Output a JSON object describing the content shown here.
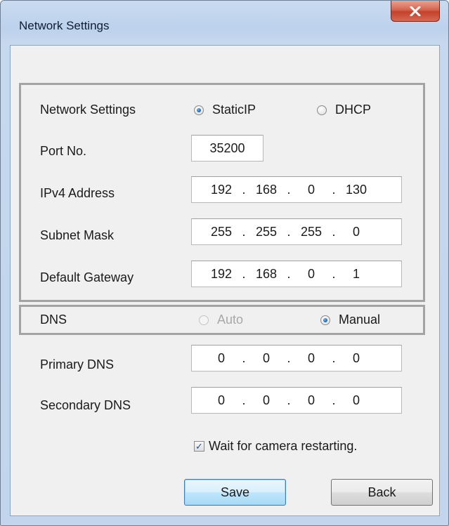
{
  "window": {
    "title": "Network Settings",
    "close_icon": "close-icon"
  },
  "network": {
    "label": "Network Settings",
    "options": [
      {
        "label": "StaticIP",
        "selected": true
      },
      {
        "label": "DHCP",
        "selected": false
      }
    ],
    "port_label": "Port No.",
    "port_value": "35200",
    "ipv4_label": "IPv4 Address",
    "ipv4": [
      "192",
      "168",
      "0",
      "130"
    ],
    "subnet_label": "Subnet Mask",
    "subnet": [
      "255",
      "255",
      "255",
      "0"
    ],
    "gateway_label": "Default Gateway",
    "gateway": [
      "192",
      "168",
      "0",
      "1"
    ]
  },
  "dns": {
    "label": "DNS",
    "options": [
      {
        "label": "Auto",
        "selected": false,
        "disabled": true
      },
      {
        "label": "Manual",
        "selected": true,
        "disabled": false
      }
    ],
    "primary_label": "Primary DNS",
    "primary": [
      "0",
      "0",
      "0",
      "0"
    ],
    "secondary_label": "Secondary DNS",
    "secondary": [
      "0",
      "0",
      "0",
      "0"
    ]
  },
  "wait_checkbox": {
    "label": "Wait for camera restarting.",
    "checked": true
  },
  "buttons": {
    "save": "Save",
    "back": "Back"
  },
  "colors": {
    "window_frame": "#c2d5ec",
    "close_button": "#c3412a",
    "group_border": "#a4a4a4",
    "default_button": "#3c7fb1"
  }
}
